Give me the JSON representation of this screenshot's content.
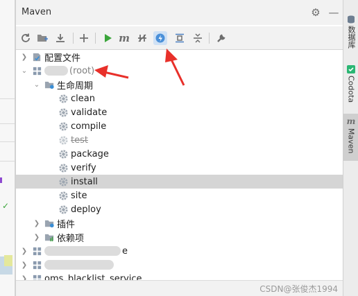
{
  "panel": {
    "title": "Maven",
    "settings_icon": "gear-icon",
    "minimize_icon": "minus-icon"
  },
  "toolbar": {
    "items": [
      {
        "name": "reload-icon",
        "hint": ""
      },
      {
        "name": "add-folder-icon",
        "hint": ""
      },
      {
        "name": "download-icon",
        "hint": ""
      },
      {
        "name": "add-icon",
        "hint": ""
      },
      {
        "name": "run-icon",
        "hint": ""
      },
      {
        "name": "maven-goal-icon",
        "hint": ""
      },
      {
        "name": "toggle-offline-icon",
        "hint": ""
      },
      {
        "name": "skip-tests-icon",
        "hint": ""
      },
      {
        "name": "show-dependencies-icon",
        "hint": ""
      },
      {
        "name": "collapse-all-icon",
        "hint": ""
      },
      {
        "name": "settings-wrench-icon",
        "hint": ""
      }
    ],
    "accent": "#4a90d9",
    "run_color": "#3aa53a"
  },
  "tree": {
    "config_files": "配置文件",
    "root_project": "(root)",
    "lifecycle": "生命周期",
    "goals": [
      "clean",
      "validate",
      "compile",
      "test",
      "package",
      "verify",
      "install",
      "site",
      "deploy"
    ],
    "selected_goal": "install",
    "plugins": "插件",
    "dependencies": "依赖项",
    "other_module_suffix": "e",
    "module_blacklist": "oms_blacklist_service"
  },
  "right_strip": {
    "tabs": [
      "数据库",
      "Codota",
      "Maven"
    ]
  },
  "watermark": "CSDN@张俊杰1994",
  "colors": {
    "annotation": "#e8302a",
    "selection": "#d5d5d5"
  }
}
